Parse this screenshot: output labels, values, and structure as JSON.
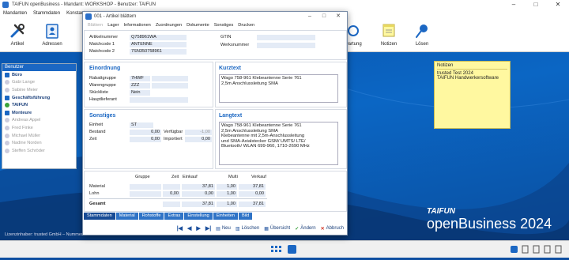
{
  "window": {
    "title": "TAIFUN openBusiness - Mandant: WORKSHOP - Benutzer: TAIFUN"
  },
  "menu": [
    "Mandanten",
    "Stammdaten",
    "Konstanten"
  ],
  "ribbon": {
    "buttons": [
      {
        "label": "Artikel",
        "icon": "tools-icon"
      },
      {
        "label": "Adressen",
        "icon": "address-book-icon"
      },
      {
        "label": "wartung",
        "icon": "maintenance-icon"
      },
      {
        "label": "Notizen",
        "icon": "notes-icon"
      },
      {
        "label": "Lösen",
        "icon": "pin-icon"
      }
    ]
  },
  "sidebar": {
    "header": "Benutzer",
    "items": [
      {
        "label": "Büro",
        "type": "group"
      },
      {
        "label": "Gabi Lange",
        "type": "user"
      },
      {
        "label": "Sabine Meier",
        "type": "user"
      },
      {
        "label": "Geschäftsführung",
        "type": "group"
      },
      {
        "label": "TAIFUN",
        "type": "active"
      },
      {
        "label": "Monteure",
        "type": "group"
      },
      {
        "label": "Andreas Appel",
        "type": "user"
      },
      {
        "label": "Fred Finke",
        "type": "user"
      },
      {
        "label": "Michael Müller",
        "type": "user"
      },
      {
        "label": "Nadine Norden",
        "type": "user"
      },
      {
        "label": "Steffen Schröder",
        "type": "user"
      }
    ]
  },
  "sticky": {
    "title": "Notizen",
    "lines": [
      "trusted Test 2024",
      "TAIFUN Handwerkersoftware"
    ]
  },
  "brand": {
    "line1": "TAIFUN",
    "line2": "openBusiness",
    "year": "2024"
  },
  "license": "Lizenzinhaber: trusted GmbH – Nummer: 104884",
  "dialog": {
    "title": "001 - Artikel blättern",
    "menu": [
      "Blättern",
      "Lager",
      "Informationen",
      "Zuordnungen",
      "Dokumente",
      "Sonstiges",
      "Drucken"
    ],
    "fields": {
      "artikelnummer_label": "Artikelnummer",
      "artikelnummer": "Q758961WA",
      "matchcode1_label": "Matchcode 1",
      "matchcode1": "ANTENNE",
      "matchcode2_label": "Matchcode 2",
      "matchcode2": "7SN350758961",
      "gtin_label": "GTIN",
      "gtin": "",
      "werksnummer_label": "Werksnummer",
      "werksnummer": ""
    },
    "einordnung": {
      "title": "Einordnung",
      "rabattgruppe_label": "Rabattgruppe",
      "rabattgruppe": "7HWF",
      "warengruppe_label": "Warengruppe",
      "warengruppe": "ZZZ",
      "stueckliste_label": "Stückliste",
      "stueckliste": "Nein",
      "hauptlieferant_label": "Hauptlieferant",
      "hauptlieferant": ""
    },
    "kurztext": {
      "title": "Kurztext",
      "text": [
        "Wago 758-961 Klebeantenne Serie 761",
        "2,5m Anschlussleitung SMA"
      ]
    },
    "sonstiges": {
      "title": "Sonstiges",
      "einheit_label": "Einheit",
      "einheit": "ST",
      "bestand_label": "Bestand",
      "bestand": "0,00",
      "verfuegbar_label": "Verfügbar",
      "verfuegbar": "-1,00",
      "zeit_label": "Zeit",
      "zeit": "0,00",
      "importiert_label": "Importiert",
      "importiert": "0,00"
    },
    "langtext": {
      "title": "Langtext",
      "text": [
        "Wago 758-961 Klebeantenne Serie 761",
        "2,5m Anschlussleitung SMA",
        "Klebeantenne mit 2,5m-Anschlussleitung",
        "und SMA-Axialstecker GSM/ UMTS/ LTE/",
        "Bluetooth/ WLAN 699-960, 1710-2690 MHz"
      ]
    },
    "price_table": {
      "headers": [
        "Gruppe",
        "Zeit",
        "Einkauf",
        "Multi",
        "Verkauf"
      ],
      "rows": [
        {
          "label": "Material",
          "gruppe": "",
          "zeit": "",
          "einkauf": "37,81",
          "multi": "1,00",
          "verkauf": "37,81"
        },
        {
          "label": "Lohn",
          "gruppe": "",
          "zeit": "0,00",
          "einkauf": "0,00",
          "multi": "1,00",
          "verkauf": "0,00"
        },
        {
          "label": "Gesamt",
          "gruppe": "",
          "zeit": "",
          "einkauf": "37,81",
          "multi": "1,00",
          "verkauf": "37,81"
        }
      ]
    },
    "tabs": [
      "Stammdaten",
      "Material",
      "Rohstoffe",
      "Extras",
      "Einstellung",
      "Einheiten",
      "Bild"
    ],
    "footer": {
      "neu": "Neu",
      "loeschen": "Löschen",
      "uebersicht": "Übersicht",
      "aendern": "Ändern",
      "abbruch": "Abbruch"
    }
  },
  "colors": {
    "accent": "#1b67c3",
    "desktop": "#0b5fba",
    "sticky": "#fff8a0"
  }
}
